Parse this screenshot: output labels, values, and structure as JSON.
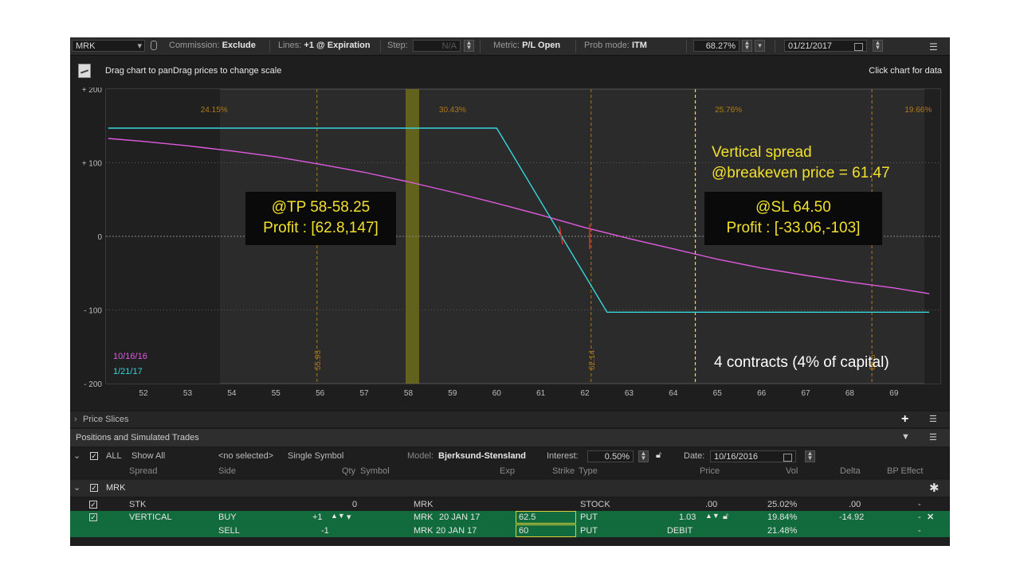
{
  "toolbar": {
    "symbol": "MRK",
    "commission_label": "Commission:",
    "commission_value": "Exclude",
    "lines_label": "Lines:",
    "lines_value": "+1 @ Expiration",
    "step_label": "Step:",
    "step_value": "N/A",
    "metric_label": "Metric:",
    "metric_value": "P/L Open",
    "prob_label": "Prob mode:",
    "prob_value": "ITM",
    "percent_value": "68.27%",
    "date_value": "01/21/2017"
  },
  "subbar": {
    "hint": "Drag chart to panDrag prices to change scale",
    "click_hint": "Click chart for data"
  },
  "chart_data": {
    "type": "line",
    "x_ticks": [
      "52",
      "53",
      "54",
      "55",
      "56",
      "57",
      "58",
      "59",
      "60",
      "61",
      "62",
      "63",
      "64",
      "65",
      "66",
      "67",
      "68",
      "69"
    ],
    "y_ticks": [
      "+ 200",
      "+ 100",
      "0",
      "- 100",
      "- 200"
    ],
    "ylim": [
      -200,
      200
    ],
    "xlim": [
      51.15,
      70.05
    ],
    "prob_labels": [
      {
        "text": "24.15%",
        "x": 53.6
      },
      {
        "text": "30.43%",
        "x": 59.0
      },
      {
        "text": "25.76%",
        "x": 65.25
      },
      {
        "text": "19.66%",
        "x": 69.55
      }
    ],
    "vertical_labels": [
      {
        "text": "55.93",
        "x": 55.93
      },
      {
        "text": "62.14",
        "x": 62.14
      },
      {
        "text": "68.5",
        "x": 68.5
      }
    ],
    "series": [
      {
        "name": "10/16/16",
        "color": "#e05ae0",
        "x": [
          51.2,
          52,
          53,
          54,
          55,
          56,
          57,
          58,
          59,
          60,
          61,
          62,
          63,
          64,
          65,
          66,
          67,
          68,
          69,
          69.8
        ],
        "y": [
          133,
          129,
          123,
          116,
          108,
          98,
          87,
          74,
          60,
          45,
          29,
          12,
          -3,
          -17,
          -31,
          -43,
          -53,
          -62,
          -70,
          -78
        ]
      },
      {
        "name": "1/21/17",
        "color": "#35d6dc",
        "x": [
          51.2,
          60.0,
          62.5,
          69.8
        ],
        "y": [
          147,
          147,
          -103,
          -103
        ]
      }
    ]
  },
  "annotations": {
    "tp_line1": "@TP 58-58.25",
    "tp_line2": "Profit : [62.8,147]",
    "sl_line1": "@SL 64.50",
    "sl_line2": "Profit : [-33.06,-103]",
    "vertical_line1": "Vertical spread",
    "vertical_line2": "@breakeven price = 61.47",
    "contracts": "4 contracts (4% of capital)"
  },
  "panels": {
    "price_slices": "Price Slices",
    "positions_title": "Positions and Simulated Trades"
  },
  "filters": {
    "all": "ALL",
    "show_all": "Show All",
    "no_selected": "<no selected>",
    "single_symbol": "Single Symbol",
    "model_label": "Model:",
    "model_value": "Bjerksund-Stensland",
    "interest_label": "Interest:",
    "interest_value": "0.50%",
    "date_label": "Date:",
    "date_value": "10/16/2016"
  },
  "columns": [
    "Spread",
    "Side",
    "Qty",
    "Symbol",
    "Exp",
    "Strike",
    "Type",
    "Price",
    "Vol",
    "Delta",
    "BP Effect"
  ],
  "group_label": "MRK",
  "rows": [
    {
      "spread": "STK",
      "side": "",
      "qty": "0",
      "symbol": "MRK",
      "exp": "",
      "strike": "",
      "type": "STOCK",
      "price": ".00",
      "vol": "25.02%",
      "delta": ".00",
      "bp": "-"
    },
    {
      "spread": "VERTICAL",
      "side": "BUY",
      "qty": "+1",
      "symbol": "MRK",
      "exp": "20 JAN 17",
      "strike": "62.5",
      "type": "PUT",
      "price": "1.03",
      "vol": "19.84%",
      "delta": "-14.92",
      "bp": "-"
    },
    {
      "spread": "",
      "side": "SELL",
      "qty": "-1",
      "symbol": "MRK",
      "exp": "20 JAN 17",
      "strike": "60",
      "type": "PUT",
      "price": "DEBIT",
      "vol": "21.48%",
      "delta": "",
      "bp": "-"
    }
  ],
  "colors": {
    "accent_green": "#116b3c",
    "curve_today": "#e05ae0",
    "curve_expiry": "#35d6dc",
    "annotation_yellow": "#f2e12c"
  }
}
